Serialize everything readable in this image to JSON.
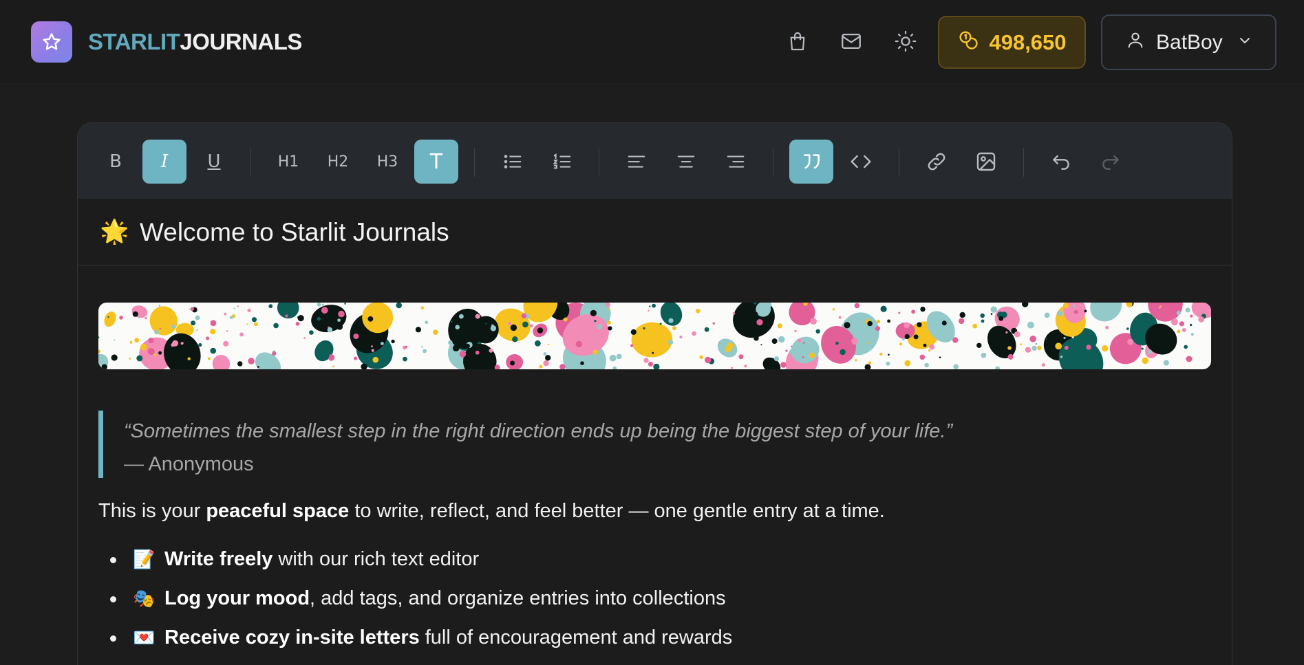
{
  "header": {
    "brand_part1": "STARLIT",
    "brand_part2": "JOURNALS",
    "coins": "498,650",
    "username": "BatBoy",
    "icons": [
      "shopping-bag-icon",
      "mail-icon",
      "sun-icon"
    ]
  },
  "toolbar": {
    "bold": "B",
    "italic": "I",
    "underline": "U",
    "h1": "H1",
    "h2": "H2",
    "h3": "H3",
    "paragraph": "T"
  },
  "entry": {
    "title_emoji": "🌟",
    "title": "Welcome to Starlit Journals",
    "quote": "“Sometimes the smallest step in the right direction ends up being the biggest step of your life.”",
    "quote_author": "— Anonymous",
    "intro_pre": "This is your ",
    "intro_bold": "peaceful space",
    "intro_post": " to write, reflect, and feel better — one gentle entry at a time.",
    "features": [
      {
        "emoji": "📝",
        "bold": "Write freely",
        "rest": "with our rich text editor"
      },
      {
        "emoji": "🎭",
        "bold": "Log your mood",
        "rest": ", add tags, and organize entries into collections"
      },
      {
        "emoji": "💌",
        "bold": "Receive cozy in-site letters",
        "rest": "full of encouragement and rewards"
      }
    ]
  },
  "colors": {
    "accent": "#6fb4c3",
    "brand_teal": "#63a9bd",
    "coin_gold": "#f7c531",
    "logo_gradient_start": "#b07ce0",
    "logo_gradient_end": "#7a86e8"
  }
}
